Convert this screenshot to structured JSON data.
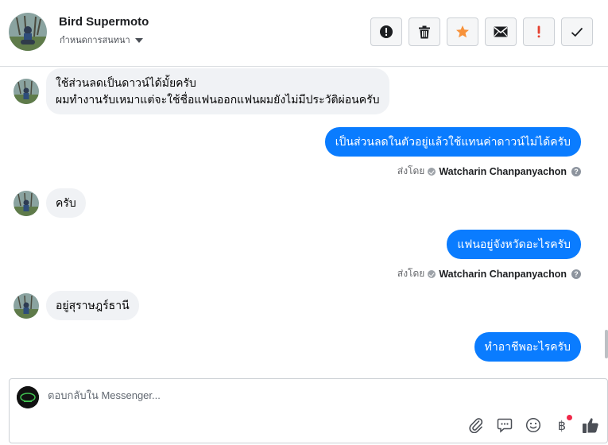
{
  "header": {
    "contact_name": "Bird Supermoto",
    "stage_label": "กำหนดการสนทนา",
    "actions": [
      {
        "name": "spam-button",
        "icon": "exclamation-circle-icon"
      },
      {
        "name": "delete-button",
        "icon": "trash-icon"
      },
      {
        "name": "star-button",
        "icon": "star-icon",
        "color": "#f7923b"
      },
      {
        "name": "mark-unread-button",
        "icon": "envelope-icon"
      },
      {
        "name": "follow-up-button",
        "icon": "exclamation-icon",
        "color": "#e4402f"
      },
      {
        "name": "mark-done-button",
        "icon": "check-icon"
      }
    ]
  },
  "messages": {
    "m1_line1": "ใช้ส่วนลดเป็นดาวน์ได้มั้ยครับ",
    "m1_line2": "ผมทำงานรับเหมาแต่จะใช้ชื่อแฟนออกแฟนผมยังไม่มีประวัติผ่อนครับ",
    "m2": "เป็นส่วนลดในตัวอยู่แล้วใช้แทนค่าดาวน์ไม่ได้ครับ",
    "m3": "ครับ",
    "m4": "แฟนอยู่จังหวัดอะไรครับ",
    "m5": "อยู่สุราษฎร์ธานี",
    "m6": "ทำอาชีพอะไรครับ"
  },
  "sent_by": {
    "prefix": "ส่งโดย",
    "agent": "Watcharin Chanpanyachon",
    "help": "?"
  },
  "composer": {
    "placeholder": "ตอบกลับใน Messenger...",
    "baht_symbol": "฿"
  },
  "colors": {
    "outgoing_bubble": "#0a7cff",
    "incoming_bubble": "#f0f2f5",
    "like": "#4b4f56",
    "notification_dot": "#f02849"
  }
}
